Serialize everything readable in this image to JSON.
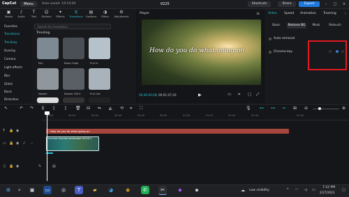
{
  "titlebar": {
    "logo": "CapCut",
    "menu_label": "Menu",
    "autosave": "Auto saved: 19:14:04",
    "project_title": "0225",
    "shortcuts_label": "Shortcuts",
    "share_label": "Share",
    "export_label": "Export"
  },
  "media_tabs": [
    {
      "label": "Media",
      "icon": "▣"
    },
    {
      "label": "Audio",
      "icon": "♪"
    },
    {
      "label": "Text",
      "icon": "T"
    },
    {
      "label": "Stickers",
      "icon": "☺"
    },
    {
      "label": "Effects",
      "icon": "✦"
    },
    {
      "label": "Transitions",
      "icon": "⧖"
    },
    {
      "label": "Captions",
      "icon": "▤"
    },
    {
      "label": "Filters",
      "icon": "◑"
    },
    {
      "label": "Adjustment",
      "icon": "⚙"
    }
  ],
  "sidebar": {
    "items": [
      "Favorites",
      "Transitions",
      "Trending",
      "Overlay",
      "Camera",
      "Light effects",
      "Blur",
      "Glitch",
      "Basic",
      "Distortion"
    ]
  },
  "search": {
    "placeholder": "Search for transitions"
  },
  "section_title": "Trending",
  "thumbnails": [
    {
      "label": "Mix",
      "color": "#7d8a94"
    },
    {
      "label": "Black Fade",
      "color": "#4a4f55"
    },
    {
      "label": "Pull In",
      "color": "#b5c2cc"
    },
    {
      "label": "Woosh",
      "color": "#8f969c"
    },
    {
      "label": "Rotate CW II",
      "color": "#5a5f66"
    },
    {
      "label": "Pull Out",
      "color": "#a8b3bb"
    }
  ],
  "player": {
    "title": "Player",
    "caption": "How do you do what going on",
    "time_current": "00:00:00:00",
    "time_total": "00:01:07:20"
  },
  "inspector": {
    "tabs": [
      "Video",
      "Speed",
      "Animation",
      "Tracking"
    ],
    "subtabs": [
      "Basic",
      "Remove BG",
      "Mask",
      "Retouch"
    ],
    "remove_label": "Auto removal",
    "chroma_label": "Chroma key"
  },
  "timeline": {
    "ruler_ticks": [
      "00:00",
      "00:10",
      "00:20",
      "00:30",
      "00:40",
      "00:50",
      "01:00",
      "01:10",
      "01:20",
      "01:30",
      "01:40"
    ],
    "text_clip": "How do you do what going on",
    "video_clip": "Sunrise  Sunrise landscape  00:00:1"
  },
  "taskbar": {
    "visibility": "Low visibility",
    "time": "7:22 PM",
    "date": "2/27/2023"
  }
}
